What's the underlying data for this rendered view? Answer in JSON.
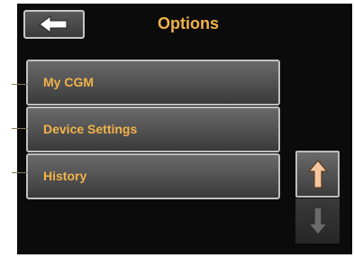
{
  "header": {
    "title": "Options",
    "back_icon": "arrow-left-icon"
  },
  "menu": {
    "items": [
      {
        "label": "My CGM"
      },
      {
        "label": "Device Settings"
      },
      {
        "label": "History"
      }
    ]
  },
  "scroll": {
    "up_icon": "arrow-up-icon",
    "down_icon": "arrow-down-icon",
    "up_enabled": true,
    "down_enabled": false
  },
  "colors": {
    "accent": "#f2b24a",
    "screen": "#0b0b0b",
    "button_border": "#c0c0c0"
  }
}
